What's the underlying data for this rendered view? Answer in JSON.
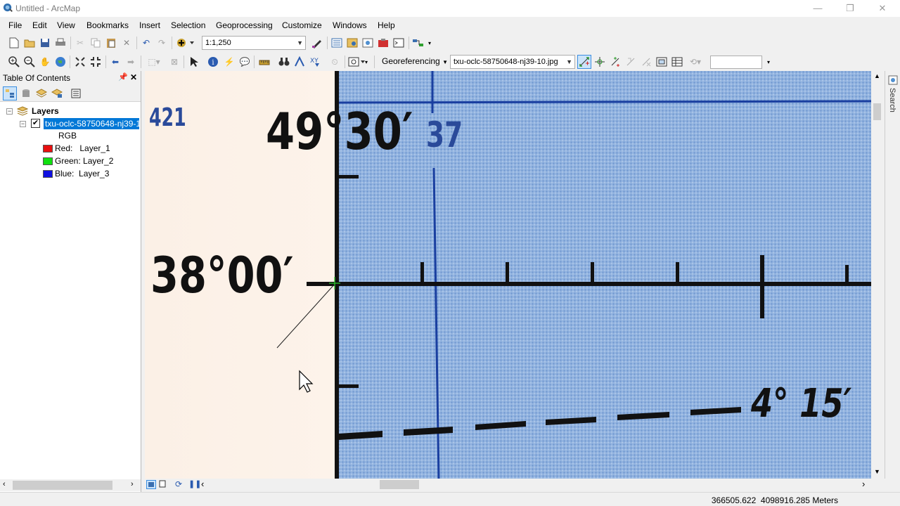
{
  "window": {
    "title": "Untitled - ArcMap",
    "minimize": "—",
    "maximize": "❐",
    "close": "✕"
  },
  "menu": [
    "File",
    "Edit",
    "View",
    "Bookmarks",
    "Insert",
    "Selection",
    "Geoprocessing",
    "Customize",
    "Windows",
    "Help"
  ],
  "toolbar": {
    "scale": "1:1,250",
    "georeferencing_label": "Georeferencing",
    "georef_layer": "txu-oclc-58750648-nj39-10.jpg",
    "blank_input": ""
  },
  "toc": {
    "title": "Table Of Contents",
    "pin": "📌",
    "close": "✕",
    "root": "Layers",
    "layer_name": "txu-oclc-58750648-nj39-10.jpg",
    "composite": "RGB",
    "bands": [
      {
        "label": "Red:   Layer_1",
        "color": "#e81010"
      },
      {
        "label": "Green: Layer_2",
        "color": "#10e010"
      },
      {
        "label": "Blue:  Layer_3",
        "color": "#1010e0"
      }
    ]
  },
  "map": {
    "grid_number_top_left": "421",
    "grid_number_top": "37",
    "latitude_top": "49°30′",
    "latitude_mid": "38°00′",
    "longitude_bottom": "4° 15′"
  },
  "side_strip_label": "Search",
  "status": {
    "coordinates": "366505.622  4098916.285 Meters"
  }
}
